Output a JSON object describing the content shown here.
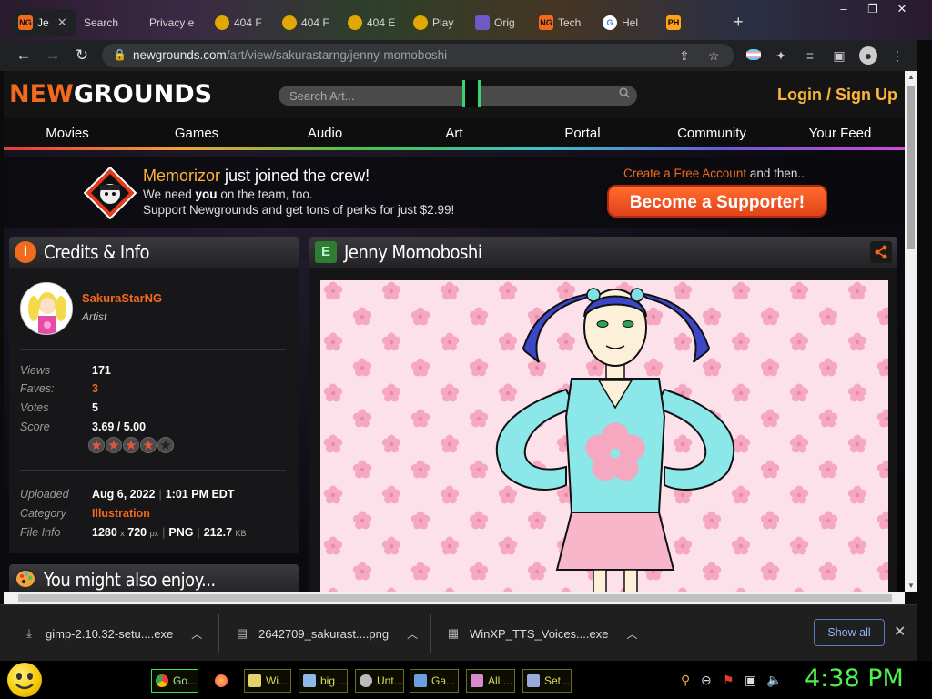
{
  "browser": {
    "tabs": [
      {
        "label": "Je",
        "favicon": "NG",
        "active": true
      },
      {
        "label": "Search",
        "favicon": ""
      },
      {
        "label": "Privacy e",
        "favicon": ""
      },
      {
        "label": "404 F",
        "favicon": ""
      },
      {
        "label": "404 F",
        "favicon": ""
      },
      {
        "label": "404 E",
        "favicon": ""
      },
      {
        "label": "Play",
        "favicon": ""
      },
      {
        "label": "Orig",
        "favicon": ""
      },
      {
        "label": "Tech",
        "favicon": "NG"
      },
      {
        "label": "Hel",
        "favicon": "G"
      },
      {
        "label": "",
        "favicon": "PH"
      }
    ],
    "url_host": "newgrounds.com",
    "url_path": "/art/view/sakurastarng/jenny-momoboshi"
  },
  "site": {
    "logo_new": "NEW",
    "logo_grounds": "GROUNDS",
    "search_placeholder": "Search Art...",
    "login_label": "Login / Sign Up",
    "nav": [
      "Movies",
      "Games",
      "Audio",
      "Art",
      "Portal",
      "Community",
      "Your Feed"
    ]
  },
  "promo": {
    "user": "Memorizor",
    "line1_rest": " just joined the crew!",
    "line2_pre": "We need ",
    "line2_bold": "you",
    "line2_post": " on the team, too.",
    "line3": "Support Newgrounds and get tons of perks for just $2.99!",
    "cta_link": "Create a Free Account",
    "cta_rest": " and then..",
    "supporter_button": "Become a Supporter!"
  },
  "credits": {
    "title": "Credits & Info",
    "artist_name": "SakuraStarNG",
    "artist_role": "Artist",
    "stats": [
      {
        "label": "Views",
        "value": "171"
      },
      {
        "label": "Faves:",
        "value": "3"
      },
      {
        "label": "Votes",
        "value": "5"
      },
      {
        "label": "Score",
        "value": "3.69 / 5.00"
      }
    ],
    "star_rating": 3.69,
    "uploaded_label": "Uploaded",
    "uploaded_date": "Aug 6, 2022",
    "uploaded_time": "1:01 PM EDT",
    "category_label": "Category",
    "category_value": "Illustration",
    "fileinfo_label": "File Info",
    "file_w": "1280",
    "file_x": "x",
    "file_h": "720",
    "file_unit": "px",
    "file_type": "PNG",
    "file_size": "212.7",
    "file_size_unit": "KB"
  },
  "also_enjoy": {
    "title": "You might also enjoy..."
  },
  "artwork": {
    "title": "Jenny Momoboshi"
  },
  "downloads": {
    "items": [
      "gimp-2.10.32-setu....exe",
      "2642709_sakurast....png",
      "WinXP_TTS_Voices....exe"
    ],
    "show_all": "Show all"
  },
  "taskbar": {
    "tasks": [
      "Go...",
      "",
      "Wi...",
      "big ...",
      "Unt...",
      "Ga...",
      "All ...",
      "Set..."
    ],
    "clock": "4:38 PM"
  },
  "colors": {
    "ng_orange": "#f26a1b",
    "ng_gold": "#fcb53b",
    "clock_green": "#4ef24e"
  }
}
